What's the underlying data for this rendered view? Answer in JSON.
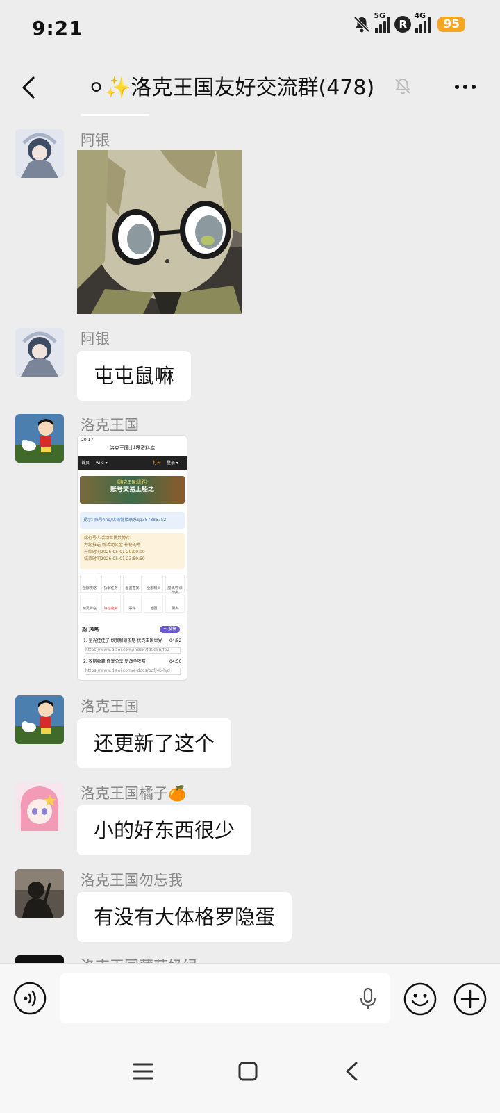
{
  "status_bar": {
    "time": "9:21",
    "signal1_label": "5G",
    "signal2_label": "4G",
    "carrier_badge": "R",
    "battery": "95",
    "icons": [
      "notifications-off-icon",
      "signal-icon",
      "roaming-icon",
      "signal-icon",
      "battery-icon"
    ]
  },
  "header": {
    "emoji_prefix": "⚪✨",
    "title": "洛克王国友好交流群(478)",
    "icons": [
      "back-icon",
      "mute-bell-icon",
      "more-icon"
    ]
  },
  "messages": [
    {
      "sender": "阿银",
      "type": "image"
    },
    {
      "sender": "阿银",
      "text": "屯屯鼠嘛"
    },
    {
      "sender": "洛克王国",
      "type": "screenshot",
      "screenshot": {
        "time": "20:17",
        "title": "洛克王国:世界资料库",
        "home": "首页",
        "nav_wiki": "wiki ▾",
        "nav_open": "打开",
        "nav_login": "登录 ▾",
        "banner_title": "《洛克王国:世界》",
        "banner_sub": "账号交易上船之",
        "tip": "提示: 账号/ing/店铺链接联系qq387886752",
        "notice_lines": [
          "比行号人活动世界共博弈!",
          "为您推送 新活动奖金 神秘的角",
          "开始时间2026-05-01 20:00:00",
          "结束时间2026-05-01 23:59:59"
        ],
        "grid_row1": [
          "全部攻略",
          "拆解任务",
          "图鉴查找",
          "全部精灵",
          "魔法/学派分类"
        ],
        "grid_row2": [
          "精灵降临",
          "好感度新",
          "事件",
          "地图",
          "更多"
        ],
        "section_title": "热门攻略",
        "section_button": "+ 投稿",
        "items": [
          {
            "title": "1. 星光佳佳了 帮我解锁攻略 优克王国世界",
            "time": "04:52",
            "link": "https://www.diaoi.com/index?fd0e8h/fe2"
          },
          {
            "title": "2. 攻略收藏 修复分享 新战争攻略",
            "time": "04:50",
            "link": "https://www.diaoi.com/e-docs/pdf/4b-h/d"
          }
        ]
      }
    },
    {
      "sender": "洛克王国",
      "text": "还更新了这个"
    },
    {
      "sender": "洛克王国橘子🍊",
      "text": "小的好东西很少"
    },
    {
      "sender": "洛克王国勿忘我",
      "text": "有没有大体格罗隐蛋"
    },
    {
      "sender": "洛克王国薄荷奶绿",
      "type": "partial"
    }
  ],
  "input_bar": {
    "icons": [
      "voice-icon",
      "microphone-icon",
      "emoji-icon",
      "plus-icon"
    ]
  },
  "nav_bar": {
    "icons": [
      "menu-icon",
      "home-icon",
      "back-icon"
    ]
  }
}
